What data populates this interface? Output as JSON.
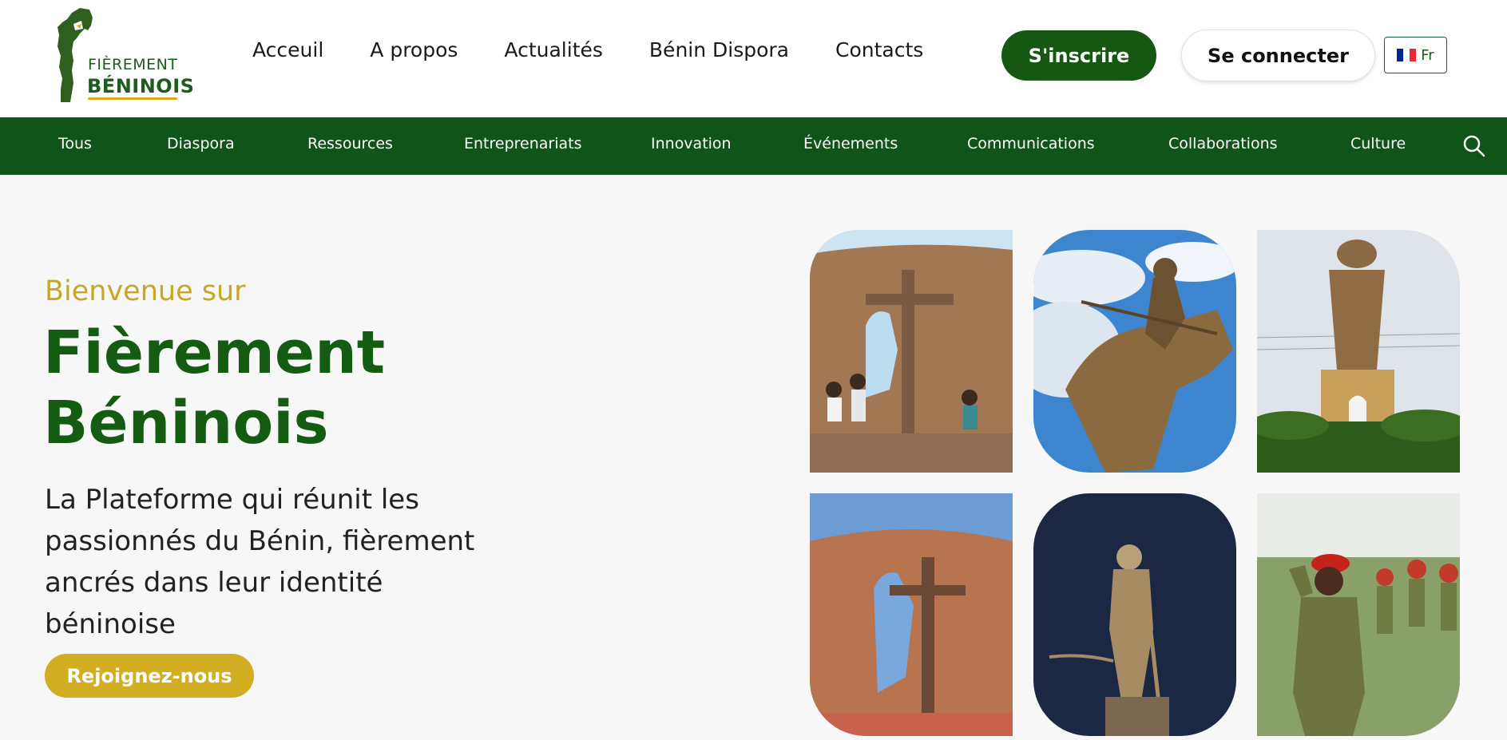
{
  "brand": {
    "logo_line1": "FIÈREMENT",
    "logo_line2": "BÉNINOIS",
    "colors": {
      "green": "#155713",
      "gold": "#d4ae22"
    }
  },
  "topnav": {
    "items": [
      "Acceuil",
      "A propos",
      "Actualités",
      "Bénin Dispora",
      "Contacts"
    ]
  },
  "auth": {
    "signup_label": "S'inscrire",
    "login_label": "Se connecter",
    "language_label": "Fr",
    "language_icon": "flag-fr-icon"
  },
  "categories": {
    "items": [
      "Tous",
      "Diaspora",
      "Ressources",
      "Entreprenariats",
      "Innovation",
      "Événements",
      "Communications",
      "Collaborations",
      "Culture"
    ],
    "search_icon": "search-icon"
  },
  "hero": {
    "kicker": "Bienvenue sur",
    "title_line1": "Fièrement",
    "title_line2": "Béninois",
    "description": "La Plateforme qui réunit les passionnés du Bénin, fièrement ancrés dans leur identité béninoise",
    "cta_label": "Rejoignez-nous"
  },
  "gallery": {
    "images": [
      "memorial-cross-photo",
      "horse-rider-statue-photo",
      "pot-statue-photo",
      "memorial-wall-photo",
      "amazon-statue-photo",
      "soldier-parade-photo"
    ]
  }
}
